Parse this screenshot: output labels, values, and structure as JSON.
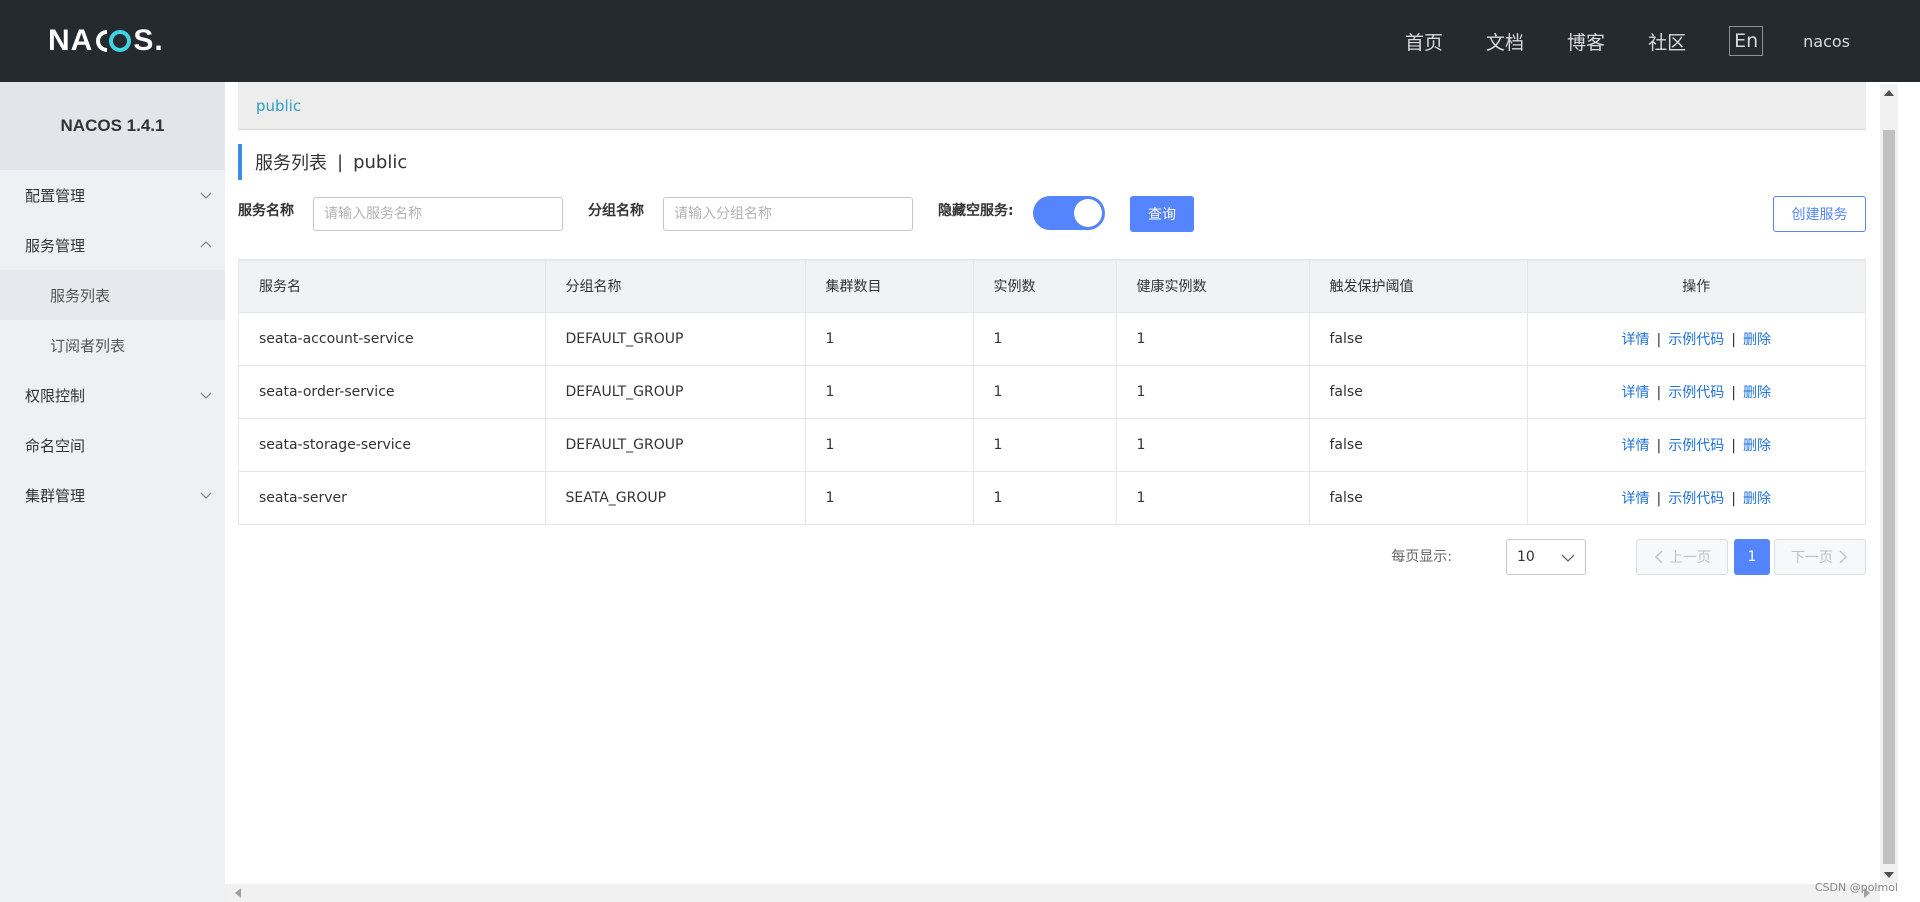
{
  "header": {
    "logo_left": "NA",
    "logo_right": "S",
    "logo_dot": ".",
    "nav": [
      "首页",
      "文档",
      "博客",
      "社区"
    ],
    "lang": "En",
    "user": "nacos"
  },
  "sidebar": {
    "title": "NACOS 1.4.1",
    "items": [
      {
        "label": "配置管理",
        "chevron": "down"
      },
      {
        "label": "服务管理",
        "chevron": "up"
      },
      {
        "label": "服务列表",
        "sub": true,
        "active": true
      },
      {
        "label": "订阅者列表",
        "sub": true
      },
      {
        "label": "权限控制",
        "chevron": "down"
      },
      {
        "label": "命名空间"
      },
      {
        "label": "集群管理",
        "chevron": "down"
      }
    ]
  },
  "breadcrumb": "public",
  "page_title": {
    "main": "服务列表",
    "sep": "|",
    "ns": "public"
  },
  "filters": {
    "service_label": "服务名称",
    "service_placeholder": "请输入服务名称",
    "group_label": "分组名称",
    "group_placeholder": "请输入分组名称",
    "hide_empty_label": "隐藏空服务:",
    "hide_empty_on": true,
    "query_button": "查询",
    "create_button": "创建服务"
  },
  "table": {
    "columns": [
      "服务名",
      "分组名称",
      "集群数目",
      "实例数",
      "健康实例数",
      "触发保护阈值",
      "操作"
    ],
    "rows": [
      [
        "seata-account-service",
        "DEFAULT_GROUP",
        "1",
        "1",
        "1",
        "false"
      ],
      [
        "seata-order-service",
        "DEFAULT_GROUP",
        "1",
        "1",
        "1",
        "false"
      ],
      [
        "seata-storage-service",
        "DEFAULT_GROUP",
        "1",
        "1",
        "1",
        "false"
      ],
      [
        "seata-server",
        "SEATA_GROUP",
        "1",
        "1",
        "1",
        "false"
      ]
    ],
    "ops": {
      "detail": "详情",
      "sample": "示例代码",
      "delete": "删除",
      "sep": "|"
    }
  },
  "pagination": {
    "page_size_label": "每页显示:",
    "page_size": "10",
    "prev": "上一页",
    "current": "1",
    "next": "下一页"
  },
  "watermark": "CSDN @polmol",
  "colors": {
    "header_bg": "#252a2f",
    "primary": "#5584ff",
    "link": "#2173d8",
    "breadcrumb": "#2fa0c8"
  }
}
